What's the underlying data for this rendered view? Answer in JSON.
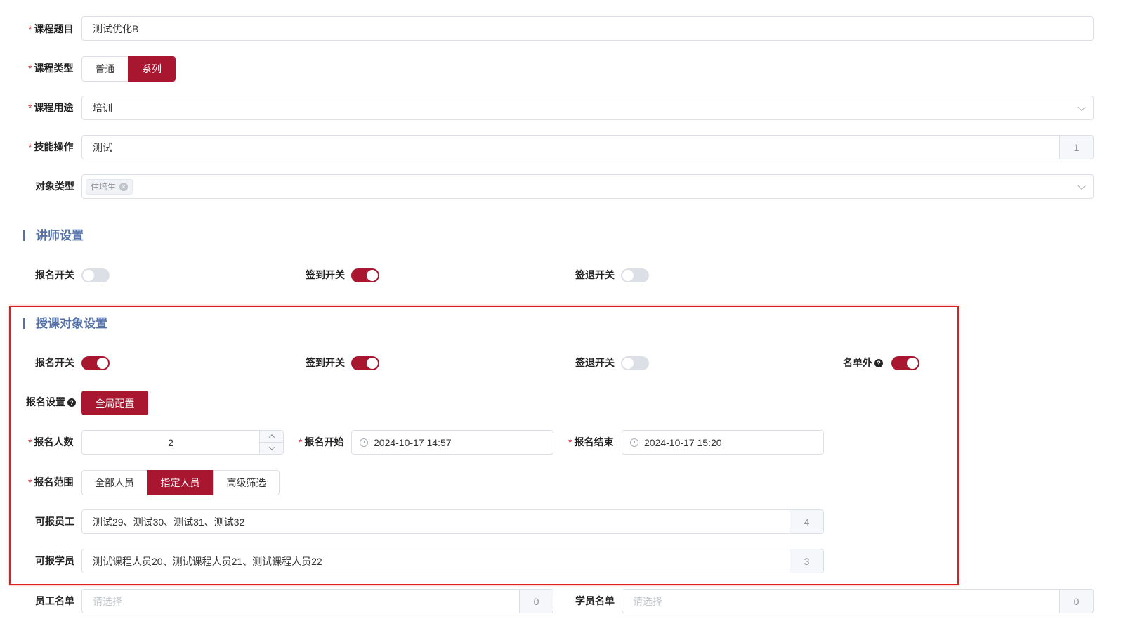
{
  "basic": {
    "title_label": "课程题目",
    "title_value": "测试优化B",
    "type_label": "课程类型",
    "type_options": [
      "普通",
      "系列"
    ],
    "type_selected": "系列",
    "usage_label": "课程用途",
    "usage_value": "培训",
    "skill_label": "技能操作",
    "skill_value": "测试",
    "skill_count": "1",
    "target_type_label": "对象类型",
    "target_type_tag": "住培生"
  },
  "lecturer": {
    "section_title": "讲师设置",
    "signup_label": "报名开关",
    "signup_on": false,
    "checkin_label": "签到开关",
    "checkin_on": true,
    "checkout_label": "签退开关",
    "checkout_on": false
  },
  "audience": {
    "section_title": "授课对象设置",
    "signup_label": "报名开关",
    "signup_on": true,
    "checkin_label": "签到开关",
    "checkin_on": true,
    "checkout_label": "签退开关",
    "checkout_on": false,
    "offlist_label": "名单外",
    "offlist_on": true,
    "signup_settings_label": "报名设置",
    "global_config_button": "全局配置",
    "signup_count_label": "报名人数",
    "signup_count_value": "2",
    "signup_start_label": "报名开始",
    "signup_start_value": "2024-10-17 14:57",
    "signup_end_label": "报名结束",
    "signup_end_value": "2024-10-17 15:20",
    "scope_label": "报名范围",
    "scope_options": [
      "全部人员",
      "指定人员",
      "高级筛选"
    ],
    "scope_selected": "指定人员",
    "staff_label": "可报员工",
    "staff_value": "测试29、测试30、测试31、测试32",
    "staff_count": "4",
    "student_label": "可报学员",
    "student_value": "测试课程人员20、测试课程人员21、测试课程人员22",
    "student_count": "3"
  },
  "lists": {
    "staff_list_label": "员工名单",
    "staff_list_placeholder": "请选择",
    "staff_list_count": "0",
    "student_list_label": "学员名单",
    "student_list_placeholder": "请选择",
    "student_list_count": "0"
  }
}
